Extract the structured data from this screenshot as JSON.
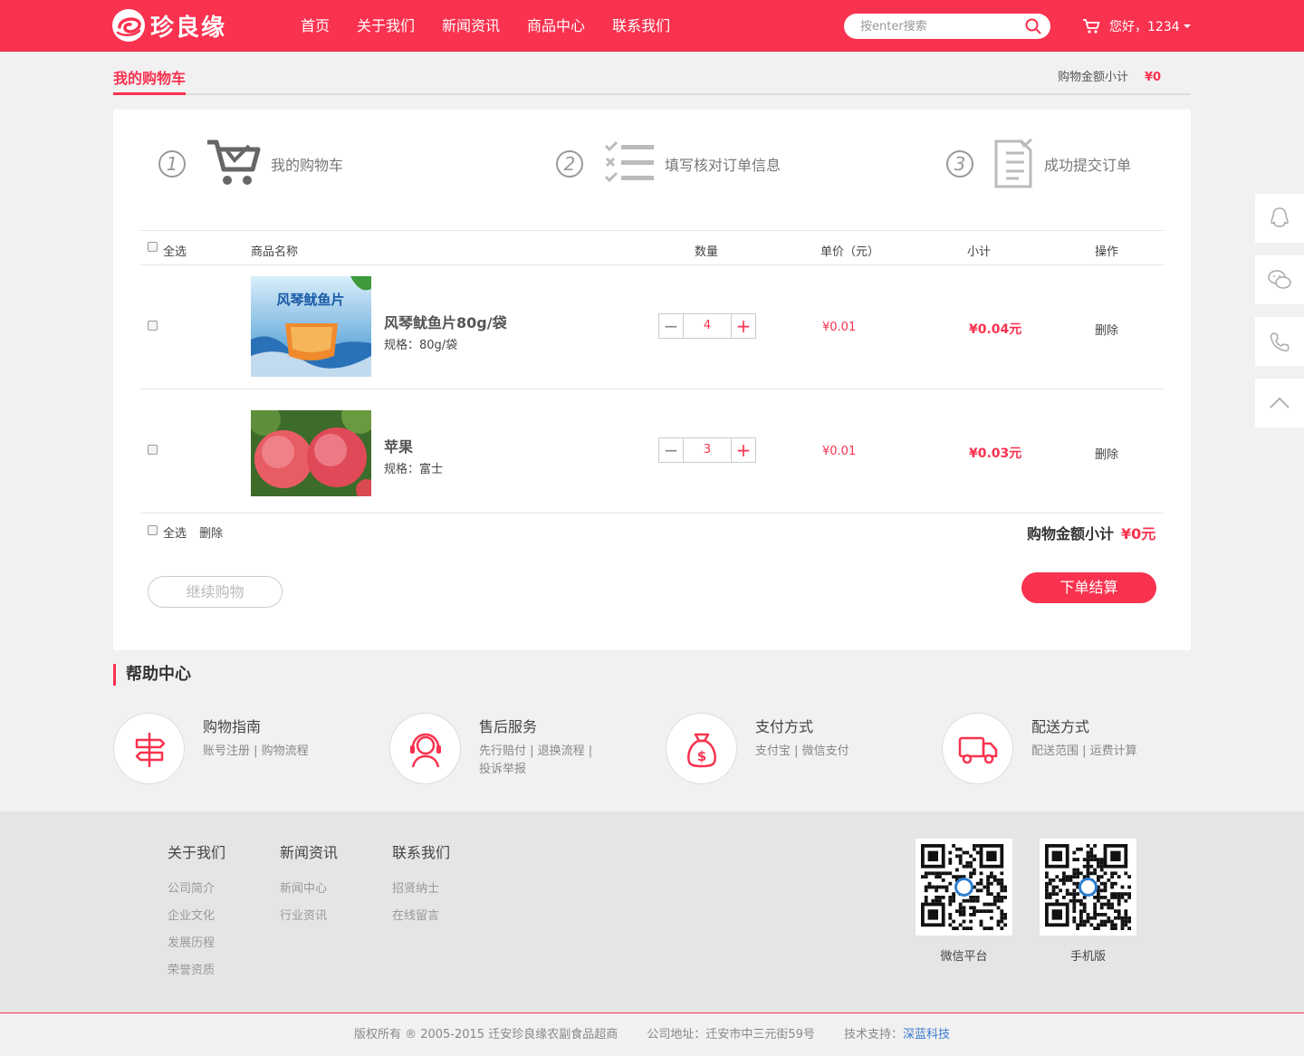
{
  "header": {
    "logo_text": "珍良缘",
    "nav": [
      "首页",
      "关于我们",
      "新闻资讯",
      "商品中心",
      "联系我们"
    ],
    "search_placeholder": "按enter搜索",
    "user_greeting": "您好，1234"
  },
  "page": {
    "title": "我的购物车",
    "subtotal_label": "购物金额小计",
    "subtotal_value": "¥0"
  },
  "steps": [
    {
      "num": "1",
      "label": "我的购物车"
    },
    {
      "num": "2",
      "label": "填写核对订单信息"
    },
    {
      "num": "3",
      "label": "成功提交订单"
    }
  ],
  "table": {
    "headers": {
      "select_all": "全选",
      "name": "商品名称",
      "qty": "数量",
      "price": "单价（元）",
      "subtotal": "小计",
      "op": "操作"
    },
    "rows": [
      {
        "name": "风琴鱿鱼片80g/袋",
        "spec": "规格：80g/袋",
        "qty": "4",
        "price": "¥0.01",
        "subtotal": "¥0.04元",
        "op": "删除",
        "img_text": "风琴鱿鱼片"
      },
      {
        "name": "苹果",
        "spec": "规格：富士",
        "qty": "3",
        "price": "¥0.01",
        "subtotal": "¥0.03元",
        "op": "删除"
      }
    ],
    "footer": {
      "select_all": "全选",
      "delete": "删除",
      "total_label": "购物金额小计",
      "total_value": "¥0元"
    }
  },
  "buttons": {
    "continue": "继续购物",
    "checkout": "下单结算"
  },
  "help": {
    "title": "帮助中心",
    "items": [
      {
        "title": "购物指南",
        "desc": "账号注册 | 购物流程"
      },
      {
        "title": "售后服务",
        "desc": "先行赔付 | 退换流程 | 投诉举报"
      },
      {
        "title": "支付方式",
        "desc": "支付宝 | 微信支付"
      },
      {
        "title": "配送方式",
        "desc": "配送范围 | 运费计算"
      }
    ]
  },
  "footer": {
    "columns": [
      {
        "title": "关于我们",
        "links": [
          "公司简介",
          "企业文化",
          "发展历程",
          "荣誉资质"
        ]
      },
      {
        "title": "新闻资讯",
        "links": [
          "新闻中心",
          "行业资讯"
        ]
      },
      {
        "title": "联系我们",
        "links": [
          "招贤纳士",
          "在线留言"
        ]
      }
    ],
    "qr": [
      "微信平台",
      "手机版"
    ],
    "copyright": "版权所有 ® 2005-2015 迁安珍良缘农副食品超商",
    "address": "公司地址：迁安市中三元街59号",
    "tech_label": "技术支持：",
    "tech_name": "深蓝科技"
  },
  "colors": {
    "brand": "#f9324f"
  }
}
